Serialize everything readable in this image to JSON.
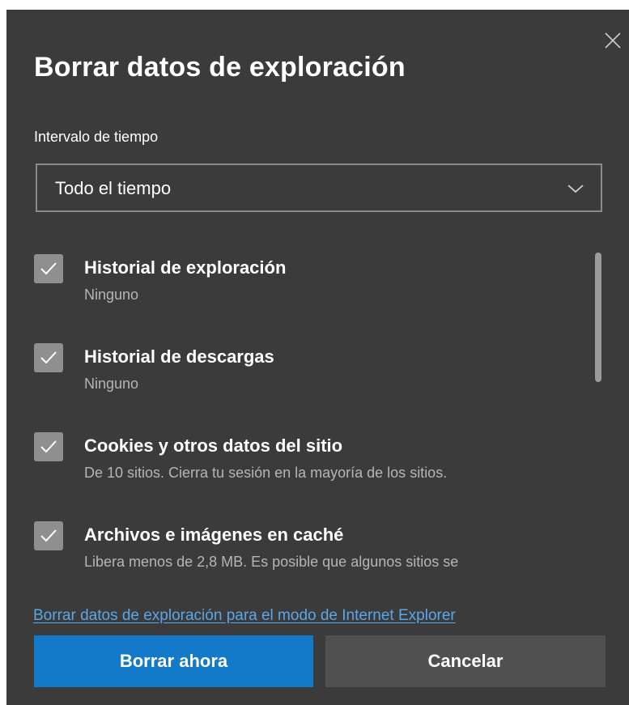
{
  "dialog": {
    "title": "Borrar datos de exploración",
    "close_icon": "close-icon"
  },
  "time_range": {
    "label": "Intervalo de tiempo",
    "selected": "Todo el tiempo",
    "chevron_icon": "chevron-down-icon"
  },
  "options": [
    {
      "title": "Historial de exploración",
      "description": "Ninguno",
      "checked": true
    },
    {
      "title": "Historial de descargas",
      "description": "Ninguno",
      "checked": true
    },
    {
      "title": "Cookies y otros datos del sitio",
      "description": "De 10 sitios. Cierra tu sesión en la mayoría de los sitios.",
      "checked": true
    },
    {
      "title": "Archivos e imágenes en caché",
      "description": "Libera menos de 2,8 MB. Es posible que algunos sitios se",
      "checked": true
    }
  ],
  "ie_link": "Borrar datos de exploración para el modo de Internet Explorer",
  "buttons": {
    "clear_now": "Borrar ahora",
    "cancel": "Cancelar"
  },
  "colors": {
    "dialog_bg": "#3b3b3b",
    "primary_button": "#1379c9",
    "secondary_button": "#505050",
    "link": "#5aa7e8",
    "checkbox_fill": "#8f8f8f"
  }
}
